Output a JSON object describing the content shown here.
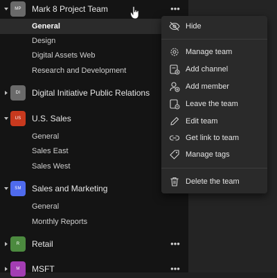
{
  "teams": [
    {
      "initials": "MP",
      "name": "Mark 8 Project Team",
      "color": "#6a6a6a",
      "channels": [
        "General",
        "Design",
        "Digital Assets Web",
        "Research and Development"
      ]
    },
    {
      "initials": "DI",
      "name": "Digital Initiative Public Relations",
      "color": "#6a6a6a",
      "channels": []
    },
    {
      "initials": "US",
      "name": "U.S. Sales",
      "color": "#c8391e",
      "channels": [
        "General",
        "Sales East",
        "Sales West"
      ]
    },
    {
      "initials": "SM",
      "name": "Sales and Marketing",
      "color": "#4f6bed",
      "channels": [
        "General",
        "Monthly Reports"
      ]
    },
    {
      "initials": "R",
      "name": "Retail",
      "color": "#4c8a3f",
      "channels": []
    },
    {
      "initials": "M",
      "name": "MSFT",
      "color": "#a33db3",
      "channels": []
    }
  ],
  "more_glyph": "•••",
  "menu": {
    "hide": "Hide",
    "manage_team": "Manage team",
    "add_channel": "Add channel",
    "add_member": "Add member",
    "leave_team": "Leave the team",
    "edit_team": "Edit team",
    "get_link": "Get link to team",
    "manage_tags": "Manage tags",
    "delete_team": "Delete the team"
  },
  "icons": {
    "hide": "eye-slash-icon",
    "manage_team": "gear-icon",
    "add_channel": "add-channel-icon",
    "add_member": "add-person-icon",
    "leave_team": "leave-icon",
    "edit_team": "pencil-icon",
    "get_link": "link-icon",
    "manage_tags": "tag-icon",
    "delete_team": "trash-icon"
  }
}
